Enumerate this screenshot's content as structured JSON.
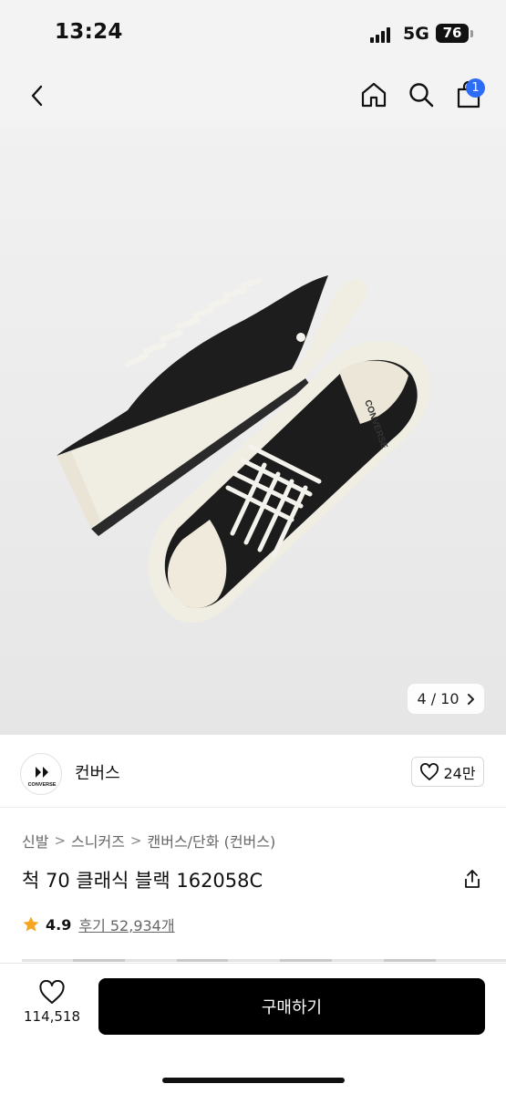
{
  "status_bar": {
    "time": "13:24",
    "network": "5G",
    "battery": "76"
  },
  "nav": {
    "icons": [
      "chevron-left-icon",
      "home-icon",
      "search-icon",
      "shopping-bag-icon"
    ],
    "cart_badge": "1"
  },
  "gallery": {
    "pager": "4 / 10",
    "pager_icon": "chevron-right-icon"
  },
  "brand": {
    "name": "컨버스",
    "logo_text": "CONVERSE",
    "like_count": "24만"
  },
  "breadcrumb": {
    "items": [
      "신발",
      "스니커즈",
      "캔버스/단화 (컨버스)"
    ],
    "separator": ">"
  },
  "product": {
    "title": "척 70 클래식 블랙 162058C"
  },
  "rating": {
    "value": "4.9",
    "reviews": "후기 52,934개"
  },
  "bottom_bar": {
    "wishlist_count": "114,518",
    "buy_label": "구매하기"
  },
  "colors": {
    "accent": "#2d6cf6",
    "star": "#f5a623",
    "buy_button": "#000000"
  }
}
